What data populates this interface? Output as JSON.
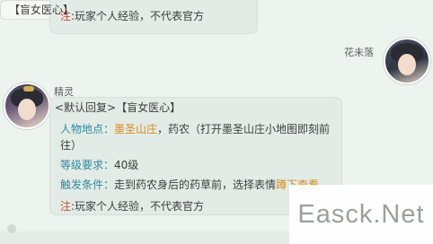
{
  "top_message": {
    "disclaimer_prefix": "注",
    "disclaimer_text": ":玩家个人经验，不代表官方"
  },
  "right_message": {
    "sender": "花未落",
    "text": "【盲女医心】"
  },
  "left_message": {
    "sender": "精灵",
    "line1": "<默认回复>【盲女医心】",
    "location_label": "人物地点：",
    "location_highlight": "墨圣山庄",
    "location_rest": "，药农（打开墨圣山庄小地图即刻前",
    "location_cont": "往）",
    "level_label": "等级要求：",
    "level_value": "40级",
    "trigger_label": "触发条件：",
    "trigger_text": "走到药农身后的药草前，选择表情",
    "trigger_highlight": "蹲下查看",
    "disclaimer_prefix": "注",
    "disclaimer_text": ":玩家个人经验，不代表官方"
  },
  "watermark": "Easck.Net",
  "colors": {
    "background": "#edf3ee",
    "bubble": "#e2ebe5",
    "accent_red": "#c84a3a",
    "accent_teal": "#2f8aa0",
    "accent_orange": "#d98a1e"
  }
}
